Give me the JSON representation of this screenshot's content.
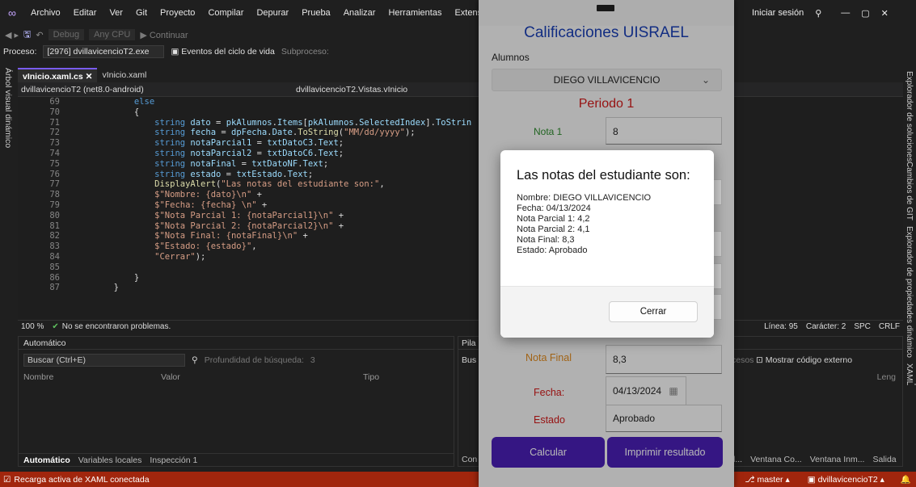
{
  "menu": {
    "items": [
      "Archivo",
      "Editar",
      "Ver",
      "Git",
      "Proyecto",
      "Compilar",
      "Depurar",
      "Prueba",
      "Analizar",
      "Herramientas",
      "Extensiones"
    ],
    "signin": "Iniciar sesión"
  },
  "toolbar": {
    "config": "Debug",
    "platform": "Any CPU",
    "run": "Continuar"
  },
  "process": {
    "label": "Proceso:",
    "value": "[2976] dvillavicencioT2.exe",
    "events": "Eventos del ciclo de vida",
    "thread": "Subproceso:"
  },
  "left_strip": {
    "label": "Árbol visual dinámico"
  },
  "right_strip": {
    "labels": [
      "Explorador de soluciones",
      "Cambios de GIT",
      "Explorador de propiedades dinámico",
      "Vista previa dinámica de XAML"
    ]
  },
  "tabs": [
    "vInicio.xaml.cs",
    "vInicio.xaml"
  ],
  "nav": {
    "project": "dvillavicencioT2 (net8.0-android)",
    "class": "dvillavicencioT2.Vistas.vInicio"
  },
  "code": {
    "lines": [
      {
        "n": "69",
        "t": "            else"
      },
      {
        "n": "70",
        "t": "            {"
      },
      {
        "n": "71",
        "t": "                string dato = pkAlumnos.Items[pkAlumnos.SelectedIndex].ToStrin"
      },
      {
        "n": "72",
        "t": "                string fecha = dpFecha.Date.ToString(\"MM/dd/yyyy\");"
      },
      {
        "n": "73",
        "t": "                string notaParcial1 = txtDatoC3.Text;"
      },
      {
        "n": "74",
        "t": "                string notaParcial2 = txtDatoC6.Text;"
      },
      {
        "n": "75",
        "t": "                string notaFinal = txtDatoNF.Text;"
      },
      {
        "n": "76",
        "t": "                string estado = txtEstado.Text;"
      },
      {
        "n": "77",
        "t": "                DisplayAlert(\"Las notas del estudiante son:\","
      },
      {
        "n": "78",
        "t": "                $\"Nombre: {dato}\\n\" +"
      },
      {
        "n": "79",
        "t": "                $\"Fecha: {fecha} \\n\" +"
      },
      {
        "n": "80",
        "t": "                $\"Nota Parcial 1: {notaParcial1}\\n\" +"
      },
      {
        "n": "81",
        "t": "                $\"Nota Parcial 2: {notaParcial2}\\n\" +"
      },
      {
        "n": "82",
        "t": "                $\"Nota Final: {notaFinal}\\n\" +"
      },
      {
        "n": "83",
        "t": "                $\"Estado: {estado}\","
      },
      {
        "n": "84",
        "t": "                \"Cerrar\");"
      },
      {
        "n": "85",
        "t": ""
      },
      {
        "n": "86",
        "t": "            }"
      },
      {
        "n": "87",
        "t": "        }"
      }
    ]
  },
  "editor_status": {
    "zoom": "100 %",
    "problems": "No se encontraron problemas.",
    "line": "Línea: 95",
    "char": "Carácter: 2",
    "spc": "SPC",
    "crlf": "CRLF"
  },
  "auto_panel": {
    "title": "Automático",
    "search": "Buscar (Ctrl+E)",
    "depth": "Profundidad de búsqueda:",
    "depth_value": "3",
    "cols": [
      "Nombre",
      "Valor",
      "Tipo"
    ],
    "bottom_tabs": [
      "Automático",
      "Variables locales",
      "Inspección 1"
    ]
  },
  "pila_panel": {
    "title": "Pila",
    "search": "Bus",
    "show_external": "Mostrar código externo",
    "processes": "cesos",
    "lang": "Leng",
    "bottom_tabs": [
      "Ventana Co...",
      "Ventana Inm...",
      "Salida"
    ],
    "bottom_left": "Con",
    "bottom_ell": "l..."
  },
  "statusbar": {
    "text": "Recarga activa de XAML conectada",
    "branch": "master",
    "project": "dvillavicencioT2"
  },
  "app": {
    "title": "Calificaciones UISRAEL",
    "alumnos_label": "Alumnos",
    "selected_alumno": "DIEGO VILLAVICENCIO",
    "periodo": "Periodo 1",
    "nota1_label": "Nota 1",
    "nota1_value": "8",
    "nota_final_label": "Nota Final",
    "nota_final_value": "8,3",
    "fecha_label": "Fecha:",
    "fecha_value": "04/13/2024",
    "estado_label": "Estado",
    "estado_value": "Aprobado",
    "calcular": "Calcular",
    "imprimir": "Imprimir resultado"
  },
  "dialog": {
    "title": "Las notas del estudiante son:",
    "body": "Nombre: DIEGO VILLAVICENCIO\nFecha: 04/13/2024\nNota Parcial 1: 4,2\nNota Parcial 2: 4,1\nNota Final: 8,3\nEstado: Aprobado",
    "button": "Cerrar"
  },
  "colors": {
    "accent": "#4a1fb6",
    "title_blue": "#1a3fb5",
    "periodo_red": "#d11a1a",
    "nota_green": "#2e8b2e",
    "orange": "#e08a1e",
    "status_red": "#a1260d"
  }
}
